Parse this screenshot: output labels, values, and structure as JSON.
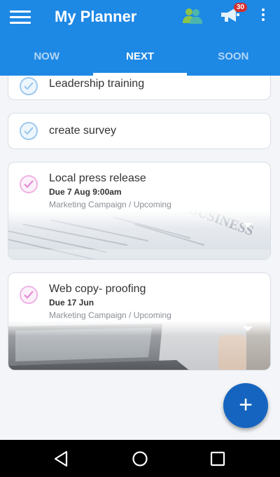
{
  "appbar": {
    "title": "My Planner",
    "notification_count": "30",
    "color": "#1e88e5",
    "icons": [
      "menu-icon",
      "people-icon",
      "megaphone-icon",
      "more-vert-icon"
    ]
  },
  "tabs": [
    {
      "label": "NOW",
      "active": false
    },
    {
      "label": "NEXT",
      "active": true
    },
    {
      "label": "SOON",
      "active": false
    }
  ],
  "tasks": [
    {
      "title": "Leadership training",
      "check_color": "#9ec9ee"
    },
    {
      "title": "create survey",
      "check_color": "#9ec9ee"
    },
    {
      "title": "Local press release",
      "due": "Due 7 Aug 9:00am",
      "path": "Marketing Campaign / Upcoming",
      "check_color": "#efb3e4",
      "image": "newspaper-business"
    },
    {
      "title": "Web copy- proofing",
      "due": "Due 17 Jun",
      "path": "Marketing Campaign / Upcoming",
      "check_color": "#efb3e4",
      "image": "laptop-desk"
    }
  ],
  "fab": {
    "label": "+",
    "color": "#1565c0"
  },
  "navbar": {
    "icons": [
      "back-icon",
      "home-icon",
      "recents-icon"
    ]
  }
}
